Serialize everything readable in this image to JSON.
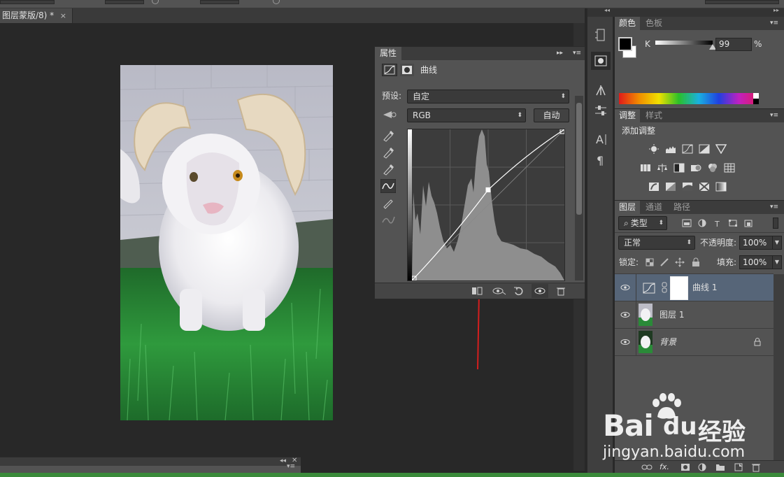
{
  "document": {
    "tab_title": "图层蒙版/8) *",
    "close_glyph": "×"
  },
  "properties": {
    "tab": "属性",
    "title": "曲线",
    "preset_label": "预设:",
    "preset_value": "自定",
    "channel_value": "RGB",
    "auto_label": "自动",
    "curve_points": [
      [
        0,
        0
      ],
      [
        0.5,
        0.6
      ],
      [
        1,
        1
      ]
    ]
  },
  "color_panel": {
    "tabs": [
      "颜色",
      "色板"
    ],
    "channel_label": "K",
    "value": "99",
    "unit": "%",
    "slider_value_percent": 99
  },
  "adjustments": {
    "tabs": [
      "调整",
      "样式"
    ],
    "add_label": "添加调整"
  },
  "layers_panel": {
    "tabs": [
      "图层",
      "通道",
      "路径"
    ],
    "filter_kind": "类型",
    "blend_mode": "正常",
    "opacity_label": "不透明度:",
    "opacity_value": "100%",
    "lock_label": "锁定:",
    "fill_label": "填充:",
    "fill_value": "100%",
    "layers": [
      {
        "name": "曲线 1",
        "selected": true
      },
      {
        "name": "图层 1",
        "selected": false
      },
      {
        "name": "背景",
        "selected": false
      }
    ],
    "footer_fx": "fx."
  },
  "watermark": {
    "brand": "Bai",
    "brand_cn": "经验",
    "url": "jingyan.baidu.com"
  },
  "colors": {
    "accent_arrow": "#d41e1e",
    "panel_bg": "#535353",
    "selected_row": "#566578",
    "status_green": "#3a8a3a"
  }
}
